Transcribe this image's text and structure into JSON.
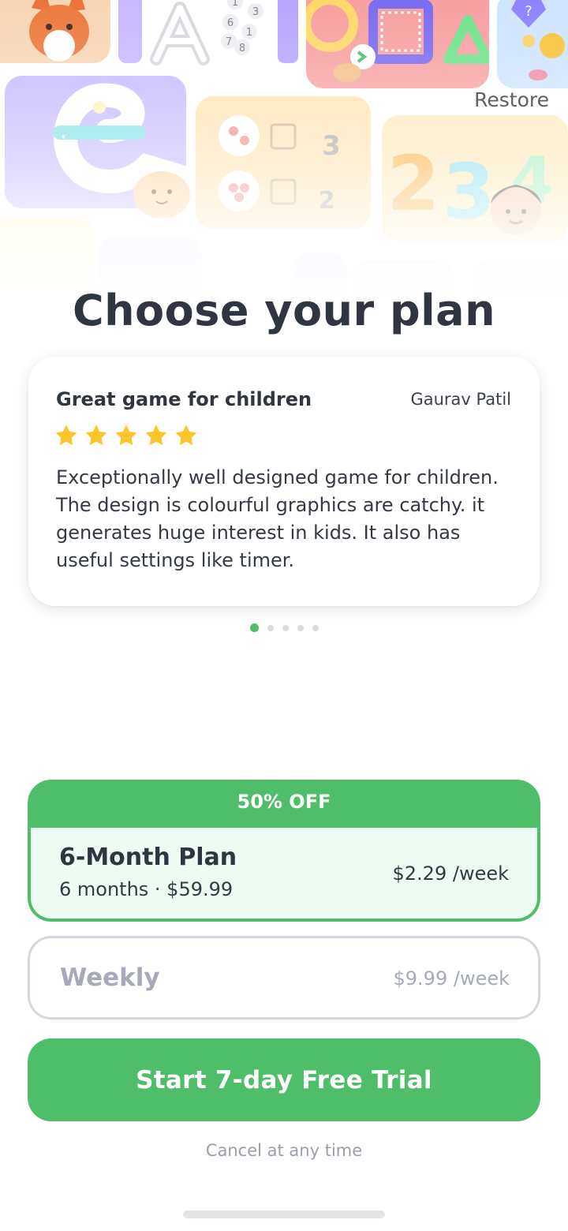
{
  "header": {
    "restore_label": "Restore"
  },
  "page": {
    "title": "Choose your plan"
  },
  "review": {
    "title": "Great game for children",
    "author": "Gaurav Patil",
    "rating": 5,
    "rating_max": 5,
    "body": "Exceptionally well designed game for children. The design is colourful graphics are catchy. it generates huge interest in kids. It also has useful settings like timer."
  },
  "pager": {
    "count": 5,
    "active_index": 0
  },
  "plans": {
    "featured": {
      "badge": "50% OFF",
      "name": "6-Month Plan",
      "subtitle": "6 months · $59.99",
      "price": "$2.29 /week",
      "selected": true
    },
    "weekly": {
      "name": "Weekly",
      "price": "$9.99 /week",
      "selected": false
    }
  },
  "cta": {
    "label": "Start 7-day Free Trial"
  },
  "footer": {
    "note": "Cancel at any time"
  },
  "collage_glyphs": {
    "letter": "A",
    "digits": [
      "1",
      "3",
      "6",
      "1",
      "7",
      "8"
    ],
    "numbers": [
      "3",
      "2",
      "2",
      "3",
      "4"
    ],
    "cursive_letter": "e"
  },
  "colors": {
    "accent_green": "#4fbe68",
    "featured_bg": "#eefbf3",
    "title_text": "#2f3541",
    "muted_text": "#a5a9ba",
    "star_yellow": "#fcc52b"
  }
}
